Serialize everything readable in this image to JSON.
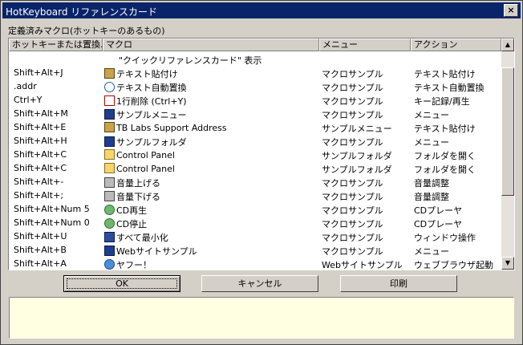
{
  "window": {
    "title": "HotKeyboard リファレンスカード",
    "close_glyph": "×"
  },
  "list_label": "定義済みマクロ(ホットキーのあるもの)",
  "columns": [
    {
      "label": "ホットキーまたは置換..."
    },
    {
      "label": "マクロ"
    },
    {
      "label": "メニュー"
    },
    {
      "label": "アクション"
    }
  ],
  "rows": [
    {
      "key": "",
      "icon": "",
      "macro": "\"クイックリファレンスカード\" 表示",
      "menu": "",
      "action": ""
    },
    {
      "key": "Shift+Alt+J",
      "icon": "paste-icon",
      "macro": "テキスト貼付け",
      "menu": "マクロサンプル",
      "action": "テキスト貼付け"
    },
    {
      "key": ".addr",
      "icon": "search-icon",
      "macro": "テキスト自動置換",
      "menu": "マクロサンプル",
      "action": "テキスト自動置換"
    },
    {
      "key": "Ctrl+Y",
      "icon": "play-icon",
      "macro": "1行削除 (Ctrl+Y)",
      "menu": "マクロサンプル",
      "action": "キー記録/再生"
    },
    {
      "key": "Shift+Alt+M",
      "icon": "menu-icon",
      "macro": "サンプルメニュー",
      "menu": "マクロサンプル",
      "action": "メニュー"
    },
    {
      "key": "Shift+Alt+E",
      "icon": "paste-icon",
      "macro": "TB Labs Support Address",
      "menu": "サンプルメニュー",
      "action": "テキスト貼付け"
    },
    {
      "key": "Shift+Alt+H",
      "icon": "menu-icon",
      "macro": "サンプルフォルダ",
      "menu": "マクロサンプル",
      "action": "メニュー"
    },
    {
      "key": "Shift+Alt+C",
      "icon": "folder-icon",
      "macro": "Control Panel",
      "menu": "サンプルフォルダ",
      "action": "フォルダを開く"
    },
    {
      "key": "Shift+Alt+C",
      "icon": "folder-icon",
      "macro": "Control Panel",
      "menu": "サンプルフォルダ",
      "action": "フォルダを開く"
    },
    {
      "key": "Shift+Alt+-",
      "icon": "speaker-icon",
      "macro": "音量上げる",
      "menu": "マクロサンプル",
      "action": "音量調整"
    },
    {
      "key": "Shift+Alt+;",
      "icon": "speaker-icon",
      "macro": "音量下げる",
      "menu": "マクロサンプル",
      "action": "音量調整"
    },
    {
      "key": "Shift+Alt+Num 5",
      "icon": "cd-icon",
      "macro": "CD再生",
      "menu": "マクロサンプル",
      "action": "CDプレーヤ"
    },
    {
      "key": "Shift+Alt+Num 0",
      "icon": "cd-icon",
      "macro": "CD停止",
      "menu": "マクロサンプル",
      "action": "CDプレーヤ"
    },
    {
      "key": "Shift+Alt+U",
      "icon": "window-icon",
      "macro": "すべて最小化",
      "menu": "マクロサンプル",
      "action": "ウィンドウ操作"
    },
    {
      "key": "Shift+Alt+B",
      "icon": "menu-icon",
      "macro": "Webサイトサンプル",
      "menu": "マクロサンプル",
      "action": "メニュー"
    },
    {
      "key": "Shift+Alt+A",
      "icon": "globe-icon",
      "macro": "ヤフー！",
      "menu": "Webサイトサンプル",
      "action": "ウェブブラウザ起動"
    }
  ],
  "scrollbar": {
    "up_glyph": "▲",
    "down_glyph": "▼"
  },
  "buttons": {
    "ok": "OK",
    "cancel": "キャンセル",
    "print": "印刷"
  },
  "description": ""
}
